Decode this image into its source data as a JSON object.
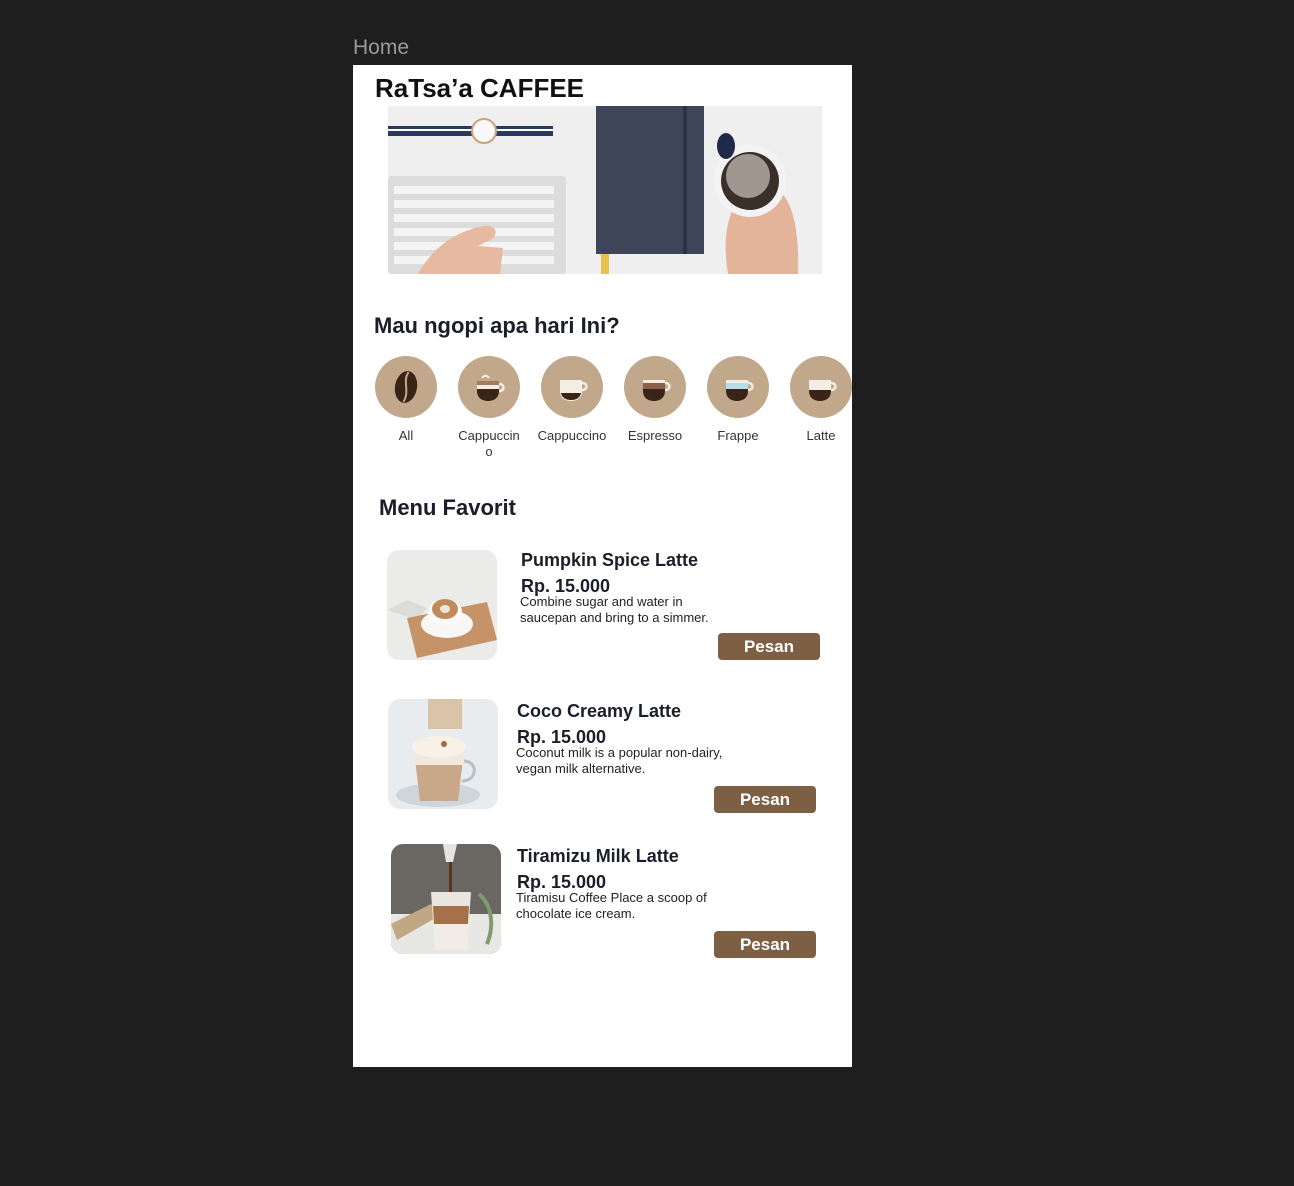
{
  "frame": {
    "label": "Home"
  },
  "app": {
    "title": "RaTsa’a CAFFEE"
  },
  "categories_section": {
    "title": "Mau ngopi apa hari Ini?"
  },
  "categories": [
    {
      "label": "All",
      "icon": "coffee-bean-icon"
    },
    {
      "label": "Cappuccino",
      "icon": "cappuccino-cup-icon"
    },
    {
      "label": "Cappuccino",
      "icon": "coffee-cup-icon"
    },
    {
      "label": "Espresso",
      "icon": "espresso-cup-icon"
    },
    {
      "label": "Frappe",
      "icon": "frappe-cup-icon"
    },
    {
      "label": "Latte",
      "icon": "latte-cup-icon"
    }
  ],
  "favorites": {
    "title": "Menu Favorit",
    "items": [
      {
        "name": "Pumpkin Spice Latte",
        "price": "Rp.  15.000",
        "description": "Combine sugar and water in saucepan and bring to a simmer.",
        "button": "Pesan"
      },
      {
        "name": "Coco Creamy Latte",
        "price": "Rp.  15.000",
        "description": "Coconut milk is a popular non-dairy, vegan milk alternative.",
        "button": "Pesan"
      },
      {
        "name": "Tiramizu Milk Latte",
        "price": "Rp.  15.000",
        "description": "Tiramisu Coffee Place a scoop of chocolate ice cream.",
        "button": "Pesan"
      }
    ]
  },
  "colors": {
    "background": "#1e1e1e",
    "screen": "#ffffff",
    "category_circle": "#c2a88b",
    "button": "#7d5f44",
    "text": "#1b1e28"
  }
}
